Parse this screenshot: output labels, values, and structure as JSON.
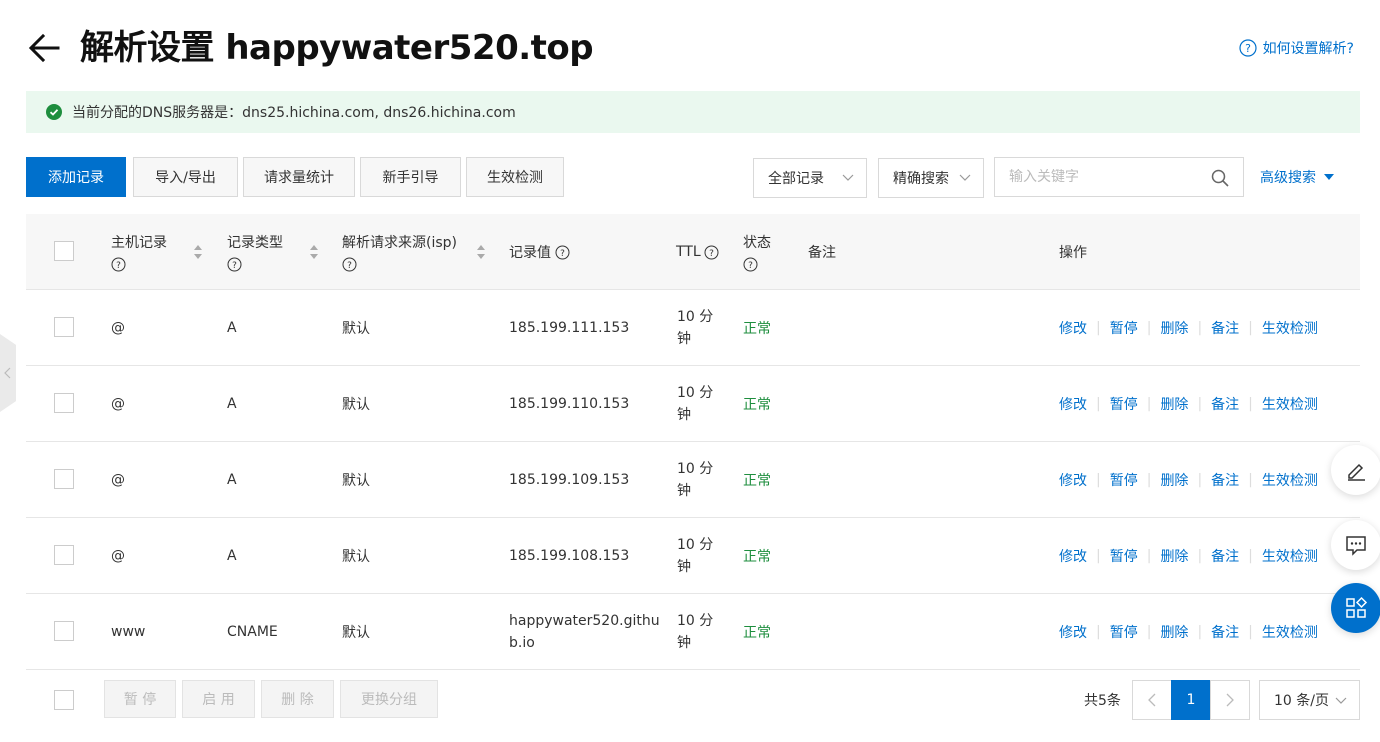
{
  "header": {
    "title": "解析设置 happywater520.top",
    "help_link": "如何设置解析?"
  },
  "notice": {
    "text": "当前分配的DNS服务器是：dns25.hichina.com, dns26.hichina.com"
  },
  "toolbar": {
    "add_record": "添加记录",
    "import_export": "导入/导出",
    "request_stats": "请求量统计",
    "guide": "新手引导",
    "effect_check": "生效检测",
    "filter_select": "全部记录",
    "search_mode": "精确搜索",
    "search_placeholder": "输入关键字",
    "advanced_search": "高级搜索"
  },
  "table": {
    "columns": {
      "host": "主机记录",
      "type": "记录类型",
      "line": "解析请求来源(isp)",
      "value": "记录值",
      "ttl": "TTL",
      "status": "状态",
      "remark": "备注",
      "actions": "操作"
    },
    "action_labels": {
      "edit": "修改",
      "pause": "暂停",
      "delete": "删除",
      "remark": "备注",
      "check": "生效检测"
    },
    "rows": [
      {
        "host": "@",
        "type": "A",
        "line": "默认",
        "value": "185.199.111.153",
        "ttl_1": "10 分",
        "ttl_2": "钟",
        "status": "正常"
      },
      {
        "host": "@",
        "type": "A",
        "line": "默认",
        "value": "185.199.110.153",
        "ttl_1": "10 分",
        "ttl_2": "钟",
        "status": "正常"
      },
      {
        "host": "@",
        "type": "A",
        "line": "默认",
        "value": "185.199.109.153",
        "ttl_1": "10 分",
        "ttl_2": "钟",
        "status": "正常"
      },
      {
        "host": "@",
        "type": "A",
        "line": "默认",
        "value": "185.199.108.153",
        "ttl_1": "10 分",
        "ttl_2": "钟",
        "status": "正常"
      },
      {
        "host": "www",
        "type": "CNAME",
        "line": "默认",
        "value_1": "happywater520.githu",
        "value_2": "b.io",
        "ttl_1": "10 分",
        "ttl_2": "钟",
        "status": "正常"
      }
    ]
  },
  "footer": {
    "pause": "暂 停",
    "enable": "启 用",
    "delete": "删 除",
    "change_group": "更换分组",
    "total": "共5条",
    "current_page": "1",
    "page_size": "10 条/页"
  },
  "colors": {
    "accent": "#0070cc",
    "status_ok": "#1e8e3e",
    "notice_bg": "#eaf8ef"
  },
  "icons": [
    "back-arrow-icon",
    "help-icon",
    "check-circle-icon",
    "chevron-down-icon",
    "search-icon",
    "caret-down-icon",
    "edit-icon",
    "feedback-icon",
    "apps-icon"
  ]
}
